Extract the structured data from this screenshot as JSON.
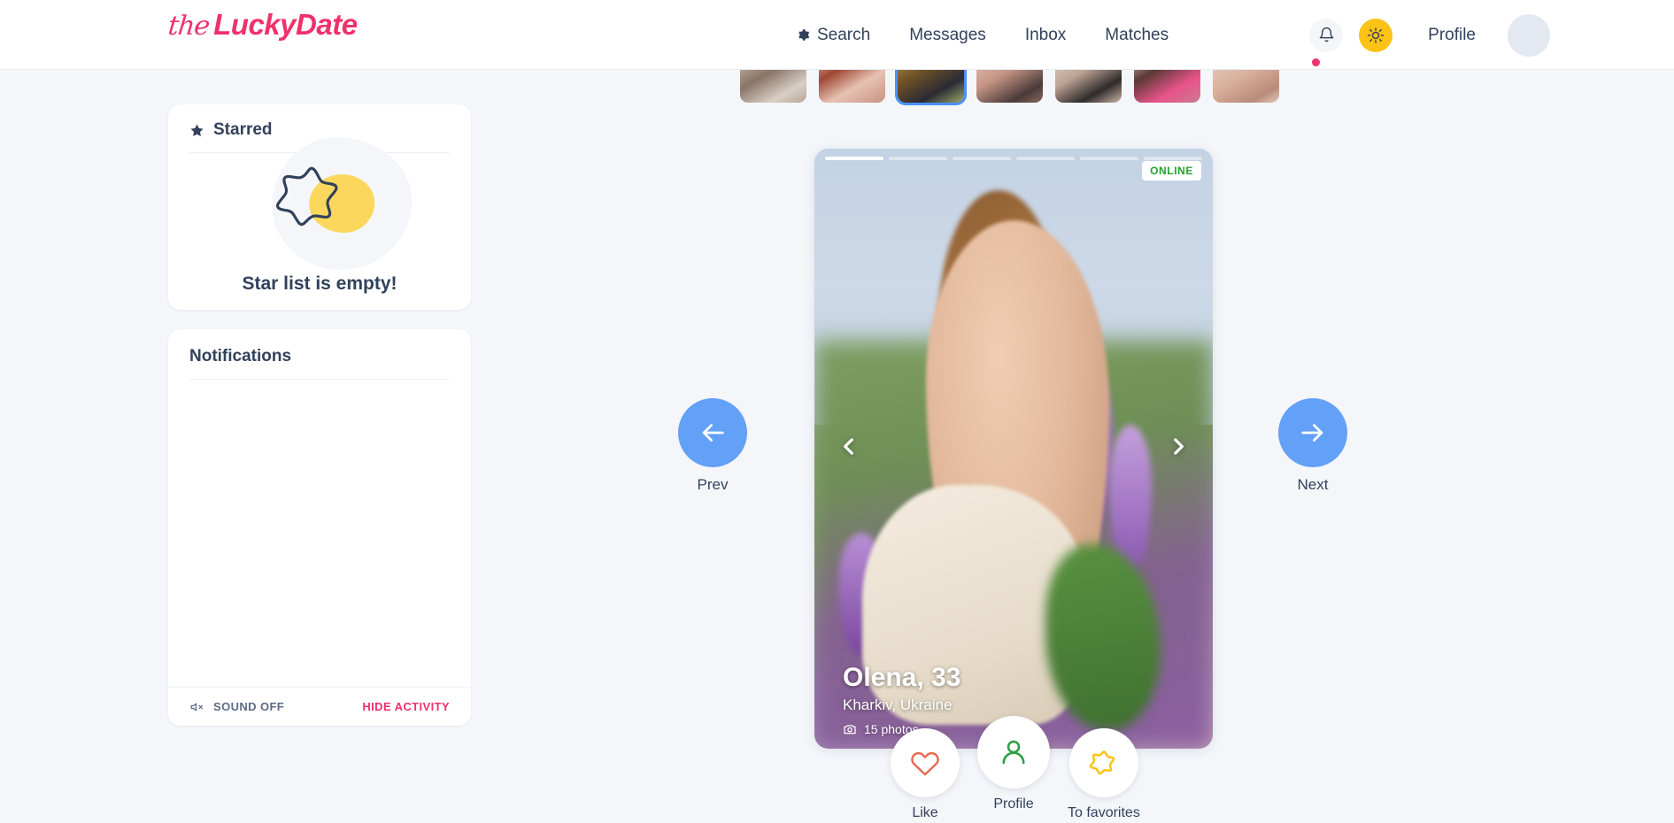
{
  "brand": {
    "prefix": "the",
    "name": "LuckyDate",
    "color": "#f0316b"
  },
  "header": {
    "nav": [
      {
        "label": "Search",
        "icon": "gear-icon"
      },
      {
        "label": "Messages",
        "icon": null
      },
      {
        "label": "Inbox",
        "icon": null
      },
      {
        "label": "Matches",
        "icon": null
      }
    ],
    "bell_icon": "bell-icon",
    "theme_icon": "sun-icon",
    "theme_color": "#fcc215",
    "profile_label": "Profile",
    "avatar": "avatar-placeholder",
    "notification_dot_color": "#f0316b"
  },
  "sidebar": {
    "starred": {
      "title": "Starred",
      "icon": "star-icon",
      "empty_text": "Star list is empty!"
    },
    "notifications": {
      "title": "Notifications",
      "sound_label": "SOUND OFF",
      "sound_icon": "speaker-mute-icon",
      "hide_label": "HIDE ACTIVITY",
      "hide_color": "#f0316b"
    }
  },
  "thumbnails": {
    "count": 7,
    "active_index": 2,
    "active_border_color": "#4a90f7",
    "items": [
      {
        "name": "thumbnail-1"
      },
      {
        "name": "thumbnail-2"
      },
      {
        "name": "thumbnail-3"
      },
      {
        "name": "thumbnail-4"
      },
      {
        "name": "thumbnail-5"
      },
      {
        "name": "thumbnail-6"
      },
      {
        "name": "thumbnail-7"
      }
    ]
  },
  "profile_card": {
    "status_badge": "ONLINE",
    "status_color": "#23a22b",
    "name_age": "Olena, 33",
    "location": "Kharkiv, Ukraine",
    "photos_count": "15 photos",
    "photos_icon": "camera-icon",
    "story_segments": 6,
    "story_active": 1,
    "prev_photo_icon": "chevron-left-icon",
    "next_photo_icon": "chevron-right-icon"
  },
  "navigation": {
    "prev": {
      "label": "Prev",
      "icon": "arrow-left-icon"
    },
    "next": {
      "label": "Next",
      "icon": "arrow-right-icon"
    },
    "button_color": "#63a0f7"
  },
  "actions": [
    {
      "label": "Like",
      "icon": "heart-icon",
      "color": "#e86a52"
    },
    {
      "label": "Profile",
      "icon": "person-icon",
      "color": "#2e9e45"
    },
    {
      "label": "To favorites",
      "icon": "star-outline-icon",
      "color": "#fcc215"
    }
  ]
}
